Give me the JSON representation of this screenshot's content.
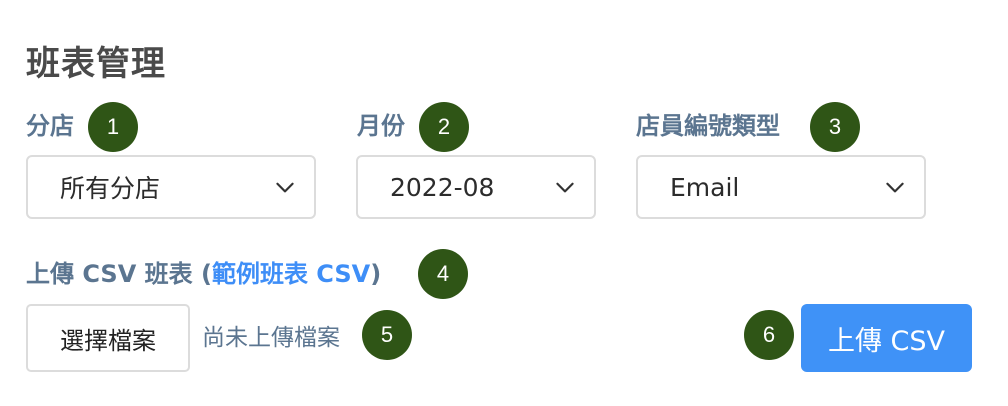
{
  "page_title": "班表管理",
  "fields": {
    "branch": {
      "label": "分店",
      "value": "所有分店",
      "badge": "1"
    },
    "month": {
      "label": "月份",
      "value": "2022-08",
      "badge": "2"
    },
    "employee_id_type": {
      "label": "店員編號類型",
      "value": "Email",
      "badge": "3"
    }
  },
  "upload": {
    "label_prefix": "上傳 CSV 班表 (",
    "example_link": "範例班表 CSV",
    "label_suffix": ")",
    "label_badge": "4",
    "choose_file_label": "選擇檔案",
    "no_file_text": "尚未上傳檔案",
    "no_file_badge": "5",
    "submit_badge": "6",
    "submit_label": "上傳 CSV"
  },
  "colors": {
    "badge": "#2f5516",
    "label": "#5b7590",
    "link": "#3e8ef7",
    "primary_button": "#3f92f7"
  },
  "icons": {
    "select_arrow": "chevron-down-icon"
  }
}
